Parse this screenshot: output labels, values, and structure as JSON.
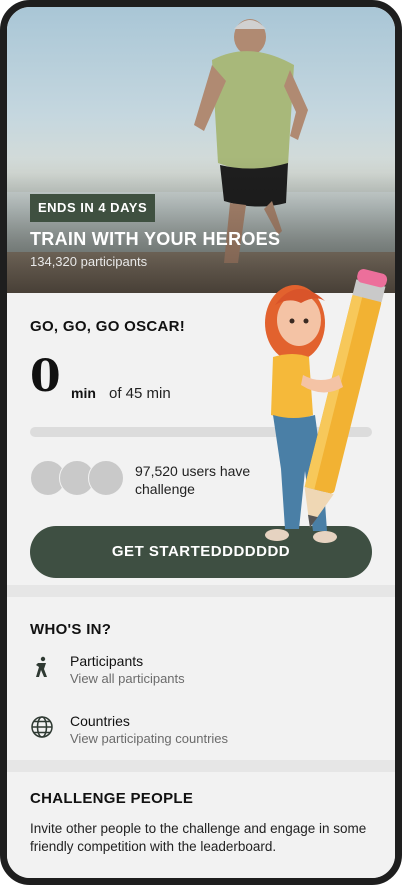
{
  "hero": {
    "badge": "ENDS IN 4 DAYS",
    "title": "TRAIN WITH YOUR HEROES",
    "participants": "134,320 participants"
  },
  "challenge": {
    "greeting": "GO, GO, GO OSCAR!",
    "minutes_done": "0",
    "minutes_unit": "min",
    "minutes_goal": "of 45 min",
    "progress_fraction": 0,
    "users_text": "97,520 users have        the challenge",
    "users_line1": "97,520 users have",
    "users_line2": "challenge",
    "cta": "GET STARTEDDDDDDD"
  },
  "whos_in": {
    "title": "WHO'S IN?",
    "items": [
      {
        "icon": "runner-icon",
        "label": "Participants",
        "sub": "View all participants"
      },
      {
        "icon": "globe-icon",
        "label": "Countries",
        "sub": "View participating countries"
      }
    ]
  },
  "challenge_people": {
    "title": "CHALLENGE PEOPLE",
    "text": "Invite other people to the challenge and engage in some friendly competition with the leaderboard."
  },
  "colors": {
    "accent": "#3e4f42",
    "background": "#f2f2f2",
    "frame": "#1e1e1e"
  }
}
